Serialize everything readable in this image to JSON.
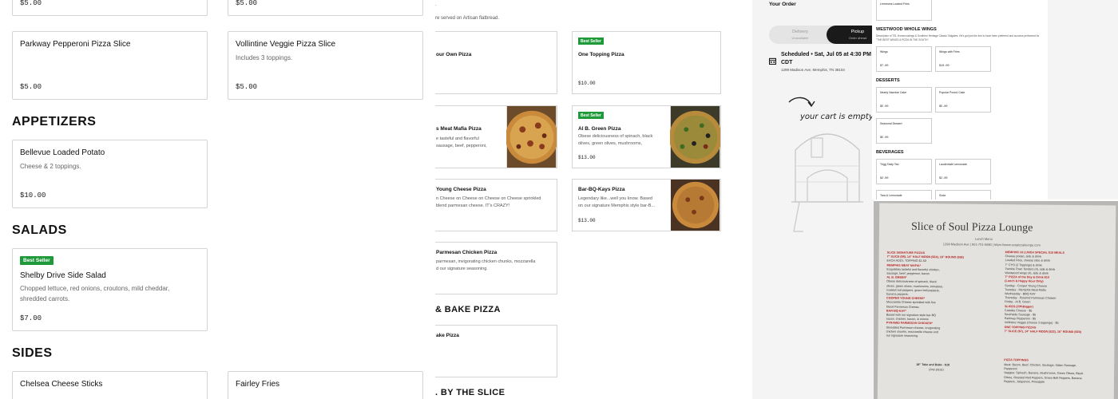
{
  "left": {
    "top_prices": [
      "$5.00",
      "$5.00"
    ],
    "slices": [
      {
        "name": "Parkway Pepperoni Pizza Slice",
        "desc": "",
        "price": "$5.00"
      },
      {
        "name": "Vollintine Veggie Pizza Slice",
        "desc": "Includes 3 toppings.",
        "price": "$5.00"
      }
    ],
    "sections": {
      "appetizers": "APPETIZERS",
      "salads": "SALADS",
      "sides": "SIDES"
    },
    "appetizer": {
      "name": "Bellevue Loaded Potato",
      "desc": "Cheese & 2 toppings.",
      "price": "$10.00"
    },
    "salad": {
      "badge": "Best Seller",
      "name": "Shelby Drive Side Salad",
      "desc_line1": "Chopped lettuce, red onions, croutons, mild cheddar,",
      "desc_line2": "shredded carrots.",
      "price": "$7.00"
    },
    "sides": [
      "Chelsea Cheese Sticks",
      "Fairley Fries"
    ]
  },
  "mid": {
    "top_desc": "re served on Artisan flatbread.",
    "top_dot": ".",
    "cards": [
      {
        "name": "our Own Pizza",
        "price": ""
      },
      {
        "badge": "Best Seller",
        "name": "One Topping Pizza",
        "price": "$10.00"
      },
      {
        "name": "s Meat Mafia Pizza",
        "desc1": "e tasteful and flavorful",
        "desc2": "sausage, beef, pepperoni,"
      },
      {
        "badge": "Best Seller",
        "name": "Al B. Green Pizza",
        "desc1": "Obese deliciousness of spinach, black",
        "desc2": "olives, green olives, mushrooms,",
        "price": "$13.00"
      },
      {
        "name": "Young Cheese Pizza",
        "desc1": "n Cheese on Cheese on Cheese on Cheese sprinkled",
        "desc2": "blend parmesan cheese. IT's CRAZY!"
      },
      {
        "name": "Bar-BQ-Kays Pizza",
        "desc1": "Legendary like...well you know. Based",
        "desc2": "on our signature Memphis style bar-B...",
        "price": "$13.00"
      },
      {
        "name": "Parmesan Chicken Pizza",
        "desc1": "parmesan, invigorating chicken chunks, mozzarella",
        "desc2": "d our signature seasoning."
      },
      {
        "name": "ake Pizza"
      }
    ],
    "sections": {
      "bake": "& BAKE PIZZA",
      "slice": ". BY THE SLICE"
    }
  },
  "right": {
    "order_title": "Your Order",
    "delivery": "Delivery",
    "delivery_sub": "Unavailable",
    "pickup": "Pickup",
    "pickup_sub": "Order ahead",
    "schedule": "Scheduled • Sat, Jul 05 at 4:30 PM CDT",
    "address": "1299 Madison Ave, Memphis, TN 38104",
    "empty_cart": "your cart is empty"
  },
  "doc": {
    "top_item": "Lemmons Loaded Fries",
    "wings_title": "WESTWOOD WHOLE WINGS",
    "wings_desc": "Description of TSL Homecookings & Southern Heritage Classic Tailgates. He's got just the line to have been preferred and success performed for \"THE BEST WINGS & PIZZA IN THE SOUTH\".",
    "wing_items": [
      {
        "name": "Wings",
        "price": "$7.00"
      },
      {
        "name": "Wings with Fries",
        "price": "$10.00"
      }
    ],
    "desserts_title": "DESSERTS",
    "dessert_items": [
      {
        "name": "Nearly Naonise Cake",
        "price": "$5.00"
      },
      {
        "name": "Popular Pound Cake",
        "price": "$5.00"
      },
      {
        "name": "Seasonal Dessert",
        "price": "$5.00"
      }
    ],
    "beverages_title": "BEVERAGES",
    "bev_items": [
      {
        "name": "Trigg Tasty Tea",
        "price": "$2.00"
      },
      {
        "name": "Lauderdale Lemonade",
        "price": "$2.00"
      },
      {
        "name": "Tara & Lemonade",
        "price": ""
      },
      {
        "name": "Soda",
        "price": ""
      }
    ]
  },
  "photo": {
    "title": "Slice of Soul Pizza Lounge",
    "subtitle": "Lunch Menu",
    "addr": "1299 Madison Ave | 901-701-5680 | https://www.sospizzalounge.com",
    "left_col": [
      {
        "t": "SLICE SIGNATURE PIZZAS",
        "c": "red"
      },
      {
        "t": "7\" SLICE ($8), 14\" HALF MOON ($24), 16\" ROUND ($36)",
        "c": "red"
      },
      {
        "t": "EACH ADD'L TOPPING $1.50",
        "c": "blk"
      },
      {
        "t": "MEMPHIS MEAT MAFIA*",
        "c": "red"
      },
      {
        "t": "Exquisitely tasteful and flavorful chicken,",
        "c": "blk"
      },
      {
        "t": "sausage, beef, pepperoni, bacon",
        "c": "blk"
      },
      {
        "t": "AL B. GREEN*",
        "c": "red"
      },
      {
        "t": "Obese deliciousness of spinach, black",
        "c": "blk"
      },
      {
        "t": "olives, green olives, mushrooms, tomatoes,",
        "c": "blk"
      },
      {
        "t": "roasted red peppers, green bell peppers,",
        "c": "blk"
      },
      {
        "t": "banana peppers.",
        "c": "blk"
      },
      {
        "t": "COOPER YOUNG CHEESE*",
        "c": "red"
      },
      {
        "t": "Mozzarella Cheese sprinkled with five",
        "c": "blk"
      },
      {
        "t": "blend Parmesan Cheese.",
        "c": "blk"
      },
      {
        "t": "BAR-BQ-KAY*",
        "c": "red"
      },
      {
        "t": "Based with our signature style bar-BQ",
        "c": "blk"
      },
      {
        "t": "sauce, chicken, bacon, & onions",
        "c": "blk"
      },
      {
        "t": "PYRAMID PARMESAN CHICKEN*",
        "c": "red"
      },
      {
        "t": "Shredded Parmesan cheese, invigorating",
        "c": "blk"
      },
      {
        "t": "chicken chunks, mozzarella cheese and",
        "c": "blk"
      },
      {
        "t": "our signature seasoning.",
        "c": "blk"
      }
    ],
    "right_col": [
      {
        "t": "MEMPHIS 10 LUNCH SPECIAL $10 MEALS",
        "c": "red"
      },
      {
        "t": "Cheese potato, side & drink",
        "c": "blk"
      },
      {
        "t": "Loaded Fries, cheese slice & drink",
        "c": "blk"
      },
      {
        "t": "7\" CYO (3 Toppings) & drink",
        "c": "blk"
      },
      {
        "t": "Twinkle Town Tenders (4), side & drink",
        "c": "blk"
      },
      {
        "t": "Westwood wings (4), side & drink",
        "c": "blk"
      },
      {
        "t": "7\" PIZZA of the Day & Drink $10",
        "c": "red"
      },
      {
        "t": "(Lunch & Happy Hour Only)",
        "c": "red"
      },
      {
        "t": "Sunday - Cooper Young Cheese",
        "c": "blk"
      },
      {
        "t": "Tuesday - Memphis Meat Mafia",
        "c": "blk"
      },
      {
        "t": "Wednesday - BBQ KAY",
        "c": "blk"
      },
      {
        "t": "Thursday - Pyramid Parmesan Chicken",
        "c": "blk"
      },
      {
        "t": "Friday - Al B. Green",
        "c": "blk"
      },
      {
        "t": "SLICES (20%Bigger)",
        "c": "red"
      },
      {
        "t": "Castalia Cheese - $5",
        "c": "blk"
      },
      {
        "t": "Southside Sausage - $5",
        "c": "blk"
      },
      {
        "t": "Parkway Pepperoni - $5",
        "c": "blk"
      },
      {
        "t": "Vollintine Veggie (choose 3 toppings) - $5",
        "c": "blk"
      },
      {
        "t": "ONE TOPPING PIZZAS",
        "c": "red"
      },
      {
        "t": "7\" SLICE ($7), 14\" HALF MOON ($22), 16\" ROUND ($30)",
        "c": "red"
      }
    ],
    "bottom": [
      "18\" Take and Bake - $18",
      "(Any pizza)"
    ],
    "toppings_title": "PIZZA TOPPINGS",
    "toppings": [
      "Meat: Bacon, Beef, Chicken, Sausage, Italian Sausage,",
      "Pepperoni",
      "Veggies: Spinach, Banana, Mushrooms, Green Olives, Black",
      "Olives, Roasted Red Peppers, Green Bell Peppers, Banana",
      "Peppers, Jalapenos, Pineapple"
    ]
  },
  "colors": {
    "badge": "#1f9a3a",
    "red_text": "#b21e1e",
    "toggle_active": "#1a1a1a"
  }
}
